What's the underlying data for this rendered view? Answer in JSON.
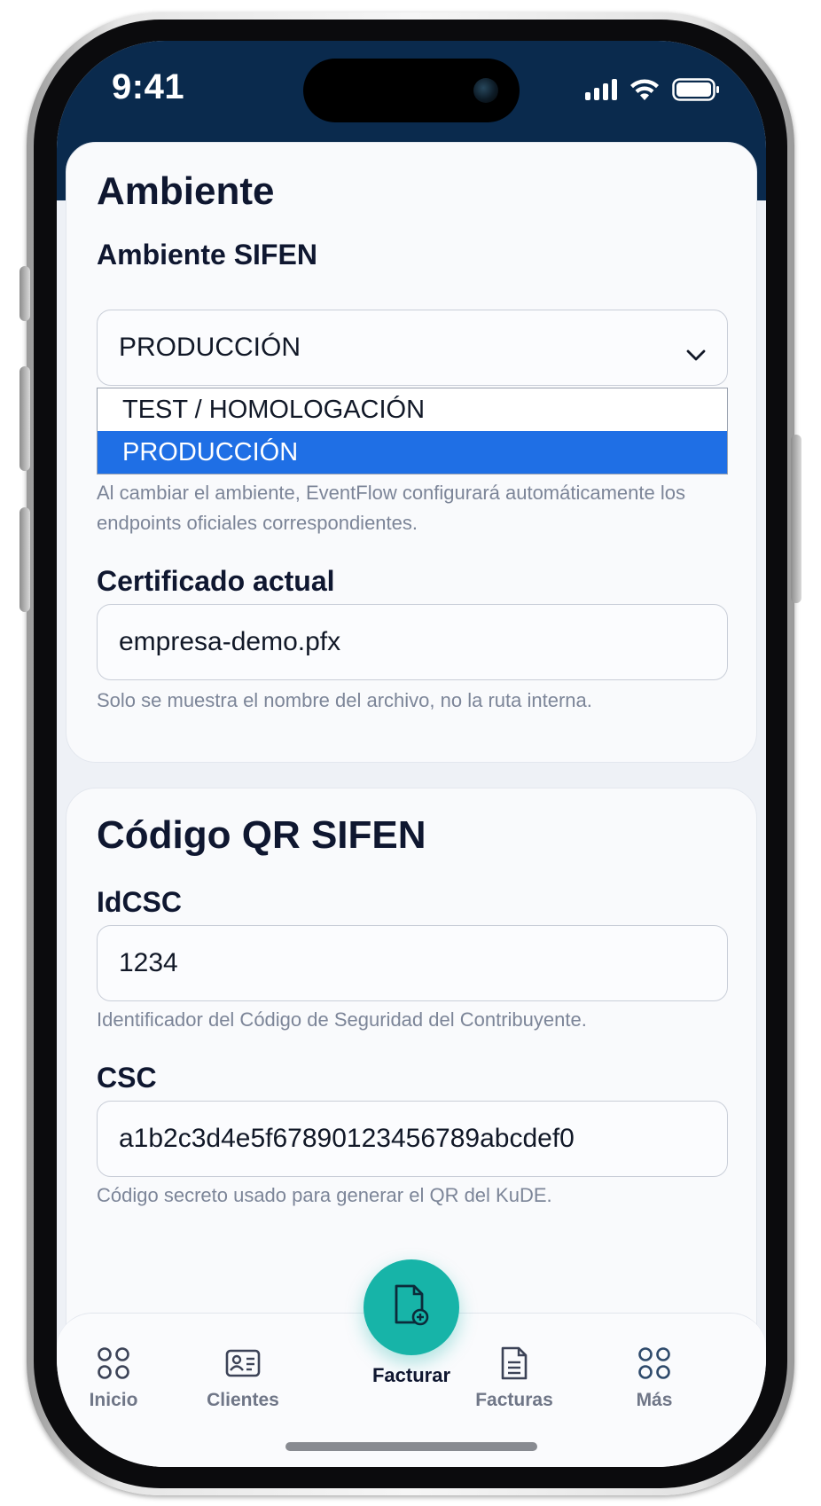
{
  "status_bar": {
    "time": "9:41"
  },
  "ambiente_section": {
    "title": "Ambiente",
    "sifen_label": "Ambiente SIFEN",
    "selected_value": "PRODUCCIÓN",
    "options": [
      "TEST / HOMOLOGACIÓN",
      "PRODUCCIÓN"
    ],
    "help": "Al cambiar el ambiente, EventFlow configurará automáticamente los endpoints oficiales correspondientes.",
    "cert_label": "Certificado actual",
    "cert_value": "empresa-demo.pfx",
    "cert_help": "Solo se muestra el nombre del archivo, no la ruta interna."
  },
  "qr_section": {
    "title": "Código QR SIFEN",
    "idcsc_label": "IdCSC",
    "idcsc_value": "1234",
    "idcsc_help": "Identificador del Código de Seguridad del Contribuyente.",
    "csc_label": "CSC",
    "csc_value": "a1b2c3d4e5f67890123456789abcdef0",
    "csc_help": "Código secreto usado para generar el QR del KuDE."
  },
  "bottom_nav": {
    "inicio": "Inicio",
    "clientes": "Clientes",
    "facturar": "Facturar",
    "facturas": "Facturas",
    "mas": "Más"
  },
  "colors": {
    "header_bg": "#0a2a4d",
    "accent_teal": "#17b4a8",
    "selection_blue": "#1f6fe5"
  },
  "icons": {
    "nav_inicio": "grid-circles-icon",
    "nav_clientes": "contact-card-icon",
    "nav_facturar": "document-add-icon",
    "nav_facturas": "document-lines-icon",
    "nav_mas": "grid-circles-icon"
  }
}
